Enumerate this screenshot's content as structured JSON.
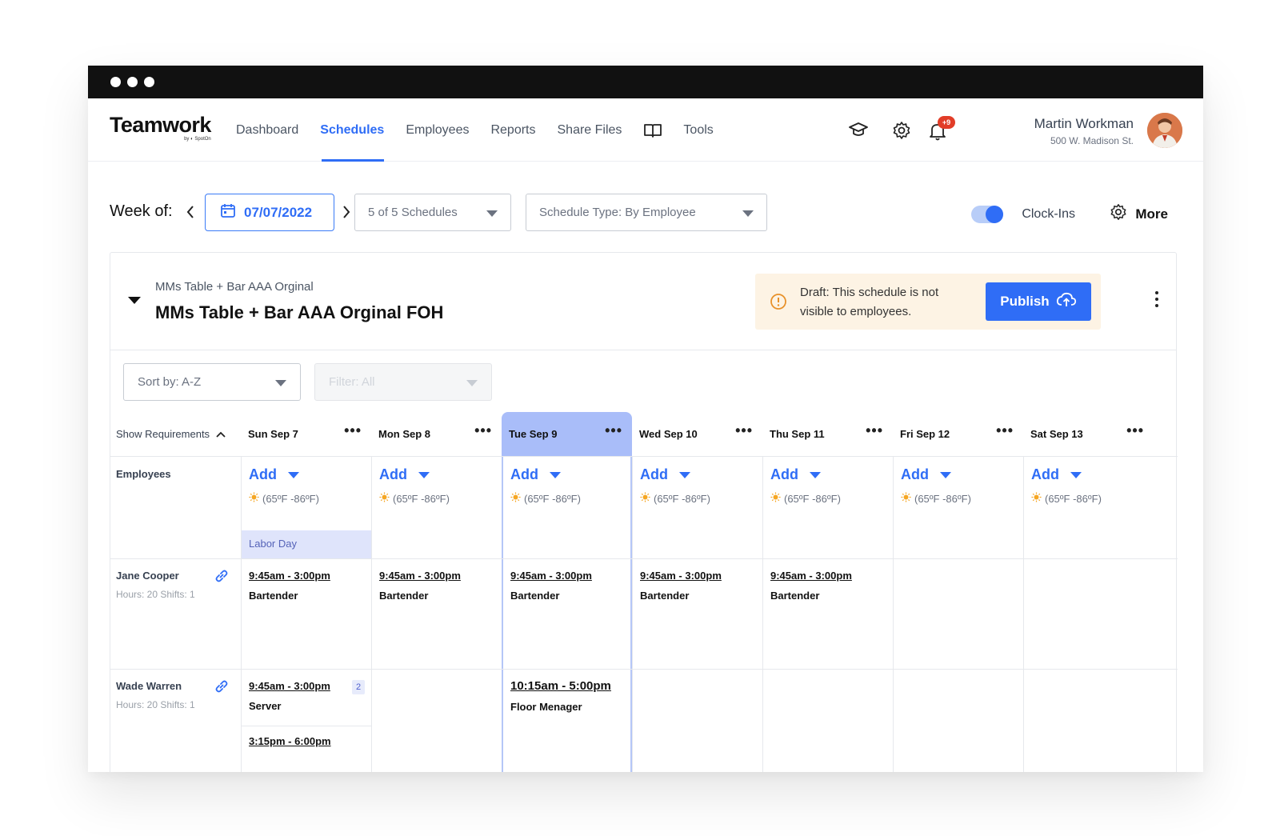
{
  "window": {
    "controls": [
      "dot",
      "dot",
      "dot"
    ]
  },
  "brand": {
    "name": "Teamwork",
    "sub": "by ◐ SpotOn"
  },
  "nav": {
    "links": [
      {
        "label": "Dashboard",
        "active": false
      },
      {
        "label": "Schedules",
        "active": true
      },
      {
        "label": "Employees",
        "active": false
      },
      {
        "label": "Reports",
        "active": false
      },
      {
        "label": "Share Files",
        "active": false
      }
    ],
    "book_icon": "book-open-icon",
    "tools_label": "Tools",
    "icons": [
      "graduation-cap-icon",
      "gear-icon",
      "bell-icon"
    ],
    "notification_badge": "+9"
  },
  "user": {
    "name": "Martin Workman",
    "address": "500 W. Madison St."
  },
  "toolbar": {
    "week_label": "Week of:",
    "date": "07/07/2022",
    "schedules_select": "5 of 5 Schedules",
    "schedule_type_select": "Schedule Type: By Employee",
    "clock_ins_label": "Clock-Ins",
    "clock_ins_enabled": true,
    "more_label": "More"
  },
  "schedule": {
    "location_sub": "MMs Table + Bar AAA Orginal",
    "location_title": "MMs Table + Bar AAA Orginal FOH",
    "draft_message": "Draft: This schedule is not visible to employees.",
    "publish_label": "Publish",
    "sort_label": "Sort by: A-Z",
    "filter_label": "Filter: All"
  },
  "grid": {
    "requirements_label": "Show Requirements",
    "employees_label": "Employees",
    "add_label": "Add",
    "days": [
      {
        "label": "Sun Sep 7",
        "weather": "(65ºF -86ºF)",
        "holiday": "Labor Day",
        "active": false
      },
      {
        "label": "Mon Sep 8",
        "weather": "(65ºF -86ºF)",
        "holiday": "",
        "active": false
      },
      {
        "label": "Tue Sep 9",
        "weather": "(65ºF -86ºF)",
        "holiday": "",
        "active": true
      },
      {
        "label": "Wed Sep 10",
        "weather": "(65ºF -86ºF)",
        "holiday": "",
        "active": false
      },
      {
        "label": "Thu Sep 11",
        "weather": "(65ºF -86ºF)",
        "holiday": "",
        "active": false
      },
      {
        "label": "Fri Sep 12",
        "weather": "(65ºF -86ºF)",
        "holiday": "",
        "active": false
      },
      {
        "label": "Sat Sep 13",
        "weather": "(65ºF -86ºF)",
        "holiday": "",
        "active": false
      }
    ],
    "employees": [
      {
        "name": "Jane Cooper",
        "meta": "Hours: 20   Shifts: 1",
        "shifts": [
          {
            "day": 0,
            "time": "9:45am - 3:00pm",
            "role": "Bartender"
          },
          {
            "day": 1,
            "time": "9:45am - 3:00pm",
            "role": "Bartender"
          },
          {
            "day": 2,
            "time": "9:45am - 3:00pm",
            "role": "Bartender"
          },
          {
            "day": 3,
            "time": "9:45am - 3:00pm",
            "role": "Bartender"
          },
          {
            "day": 4,
            "time": "9:45am - 3:00pm",
            "role": "Bartender"
          }
        ]
      },
      {
        "name": "Wade Warren",
        "meta": "Hours: 20   Shifts: 1",
        "shifts": [
          {
            "day": 0,
            "time": "9:45am - 3:00pm",
            "role": "Server",
            "badge": "2",
            "extra_time": "3:15pm - 6:00pm"
          },
          {
            "day": 2,
            "time": "10:15am - 5:00pm",
            "role": "Floor Menager"
          }
        ]
      }
    ]
  },
  "colors": {
    "accent": "#2f6df6",
    "active_day": "#a9bdf9",
    "holiday_bg": "#dfe4fb",
    "draft_bg": "#fdf3e4",
    "badge": "#e23d28"
  }
}
